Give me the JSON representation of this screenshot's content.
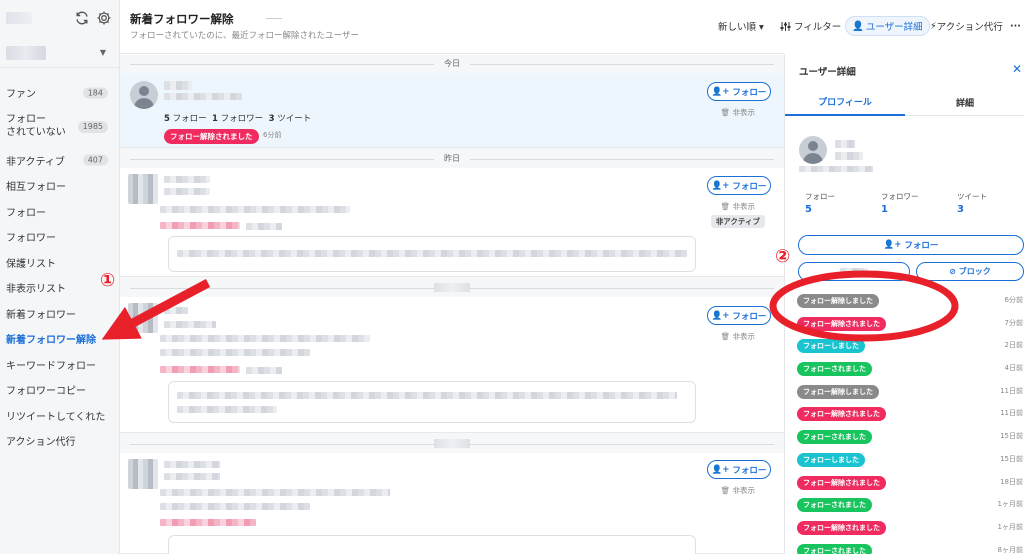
{
  "sidebar": {
    "items": [
      {
        "label": "ファン",
        "badge": "184"
      },
      {
        "label": "フォロー\nされていない",
        "badge": "1985"
      },
      {
        "label": "非アクティブ",
        "badge": "407"
      },
      {
        "label": "相互フォロー"
      },
      {
        "label": "フォロー"
      },
      {
        "label": "フォロワー"
      },
      {
        "label": "保護リスト"
      },
      {
        "label": "非表示リスト"
      },
      {
        "label": "新着フォロワー"
      },
      {
        "label": "新着フォロワー解除",
        "active": true
      },
      {
        "label": "キーワードフォロー"
      },
      {
        "label": "フォロワーコピー"
      },
      {
        "label": "リツイートしてくれた"
      },
      {
        "label": "アクション代行"
      }
    ]
  },
  "header": {
    "title": "新着フォロワー解除",
    "subtitle": "フォローされていたのに、最近フォロー解除されたユーザー"
  },
  "toolbar": {
    "sort": "新しい順 ▾",
    "filter": "フィルター",
    "user_detail": "ユーザー詳細",
    "action": "アクション代行",
    "more": "···"
  },
  "feed": {
    "sep_today": "今日",
    "sep_yesterday": "昨日",
    "card1": {
      "following_count": "5",
      "following_label": "フォロー",
      "followers_count": "1",
      "followers_label": "フォロワー",
      "tweets_count": "3",
      "tweets_label": "ツイート",
      "status": "フォロー解除されました",
      "ago": "6分前"
    },
    "follow_label": "フォロー",
    "hide_label": "非表示",
    "inactive_label": "非アクティブ"
  },
  "panel": {
    "title": "ユーザー詳細",
    "tab_profile": "プロフィール",
    "tab_detail": "詳細",
    "following_label": "フォロー",
    "following_value": "5",
    "followers_label": "フォロワー",
    "followers_value": "1",
    "tweets_label": "ツイート",
    "tweets_value": "3",
    "follow_btn": "フォロー",
    "block_btn": "ブロック",
    "history": [
      {
        "label": "フォロー解除しました",
        "color": "#8a8a8a",
        "time": "6分前"
      },
      {
        "label": "フォロー解除されました",
        "color": "#ef2b5f",
        "time": "7分前"
      },
      {
        "label": "フォローしました",
        "color": "#19c3cf",
        "time": "2日前"
      },
      {
        "label": "フォローされました",
        "color": "#17c45e",
        "time": "4日前"
      },
      {
        "label": "フォロー解除しました",
        "color": "#8a8a8a",
        "time": "11日前"
      },
      {
        "label": "フォロー解除されました",
        "color": "#ef2b5f",
        "time": "11日前"
      },
      {
        "label": "フォローされました",
        "color": "#17c45e",
        "time": "15日前"
      },
      {
        "label": "フォローしました",
        "color": "#19c3cf",
        "time": "15日前"
      },
      {
        "label": "フォロー解除されました",
        "color": "#ef2b5f",
        "time": "18日前"
      },
      {
        "label": "フォローされました",
        "color": "#17c45e",
        "time": "1ヶ月前"
      },
      {
        "label": "フォロー解除されました",
        "color": "#ef2b5f",
        "time": "1ヶ月前"
      },
      {
        "label": "フォローされました",
        "color": "#17c45e",
        "time": "8ヶ月前"
      }
    ]
  },
  "annotations": {
    "num1": "①",
    "num2": "②"
  },
  "colors": {
    "accent": "#1d6fd8",
    "annotation_red": "#e8202a",
    "unfollowed": "#ef2b5f"
  }
}
